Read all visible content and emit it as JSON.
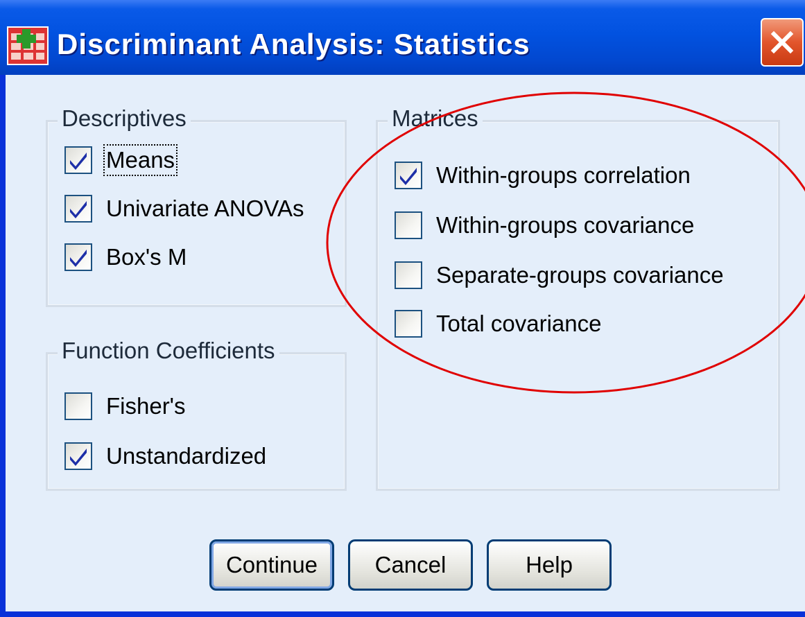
{
  "window": {
    "title": "Discriminant Analysis: Statistics",
    "icon": "spss-dialog-icon",
    "close_icon": "close-icon"
  },
  "descriptives": {
    "label": "Descriptives",
    "items": [
      {
        "label": "Means",
        "checked": true
      },
      {
        "label": "Univariate ANOVAs",
        "checked": true
      },
      {
        "label": "Box's M",
        "checked": true
      }
    ]
  },
  "function_coefficients": {
    "label": "Function Coefficients",
    "items": [
      {
        "label": "Fisher's",
        "checked": false
      },
      {
        "label": "Unstandardized",
        "checked": true
      }
    ]
  },
  "matrices": {
    "label": "Matrices",
    "items": [
      {
        "label": "Within-groups correlation",
        "checked": true
      },
      {
        "label": "Within-groups covariance",
        "checked": false
      },
      {
        "label": "Separate-groups covariance",
        "checked": false
      },
      {
        "label": "Total covariance",
        "checked": false
      }
    ]
  },
  "buttons": {
    "continue": "Continue",
    "cancel": "Cancel",
    "help": "Help"
  },
  "colors": {
    "titlebar": "#0252e0",
    "client": "#e4eefa",
    "annotation": "#e00000",
    "check": "#1d2fa8"
  }
}
